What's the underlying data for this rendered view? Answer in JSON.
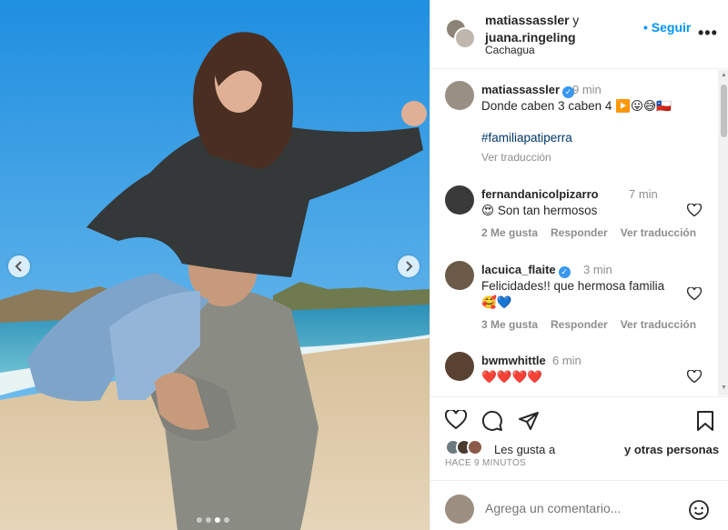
{
  "header": {
    "user1": "matiassassler",
    "conj": "y",
    "user2": "juana.ringeling",
    "location": "Cachagua",
    "follow": "Seguir",
    "more": "•••"
  },
  "post": {
    "author": "matiassassler",
    "time": "9 min",
    "caption": "Donde caben 3 caben 4",
    "caption_emoji": "▶️😛😅🇨🇱",
    "hashtag": "#familiapatiperra",
    "translate": "Ver traducción"
  },
  "comments": [
    {
      "user": "fernandanicolpizarro",
      "time": "7 min",
      "text": "😍 Son tan hermosos",
      "likes": "2 Me gusta",
      "reply": "Responder",
      "translate": "Ver traducción"
    },
    {
      "user": "lacuica_flaite",
      "time": "3 min",
      "text": "Felicidades!! que hermosa familia",
      "text2": "🥰💙",
      "likes": "3 Me gusta",
      "reply": "Responder",
      "translate": "Ver traducción"
    },
    {
      "user": "bwmwhittle",
      "time": "6 min",
      "text": "❤️❤️❤️❤️"
    }
  ],
  "likes": {
    "prefix": "Les gusta a",
    "others": "y otras personas",
    "time_ago": "HACE 9 MINUTOS"
  },
  "add_comment": {
    "placeholder": "Agrega un comentario..."
  },
  "carousel": {
    "slide_count": 4,
    "active_slide": 3
  },
  "colors": {
    "accent": "#0095f6",
    "verified": "#3897f0",
    "muted": "#8e8e8e"
  }
}
